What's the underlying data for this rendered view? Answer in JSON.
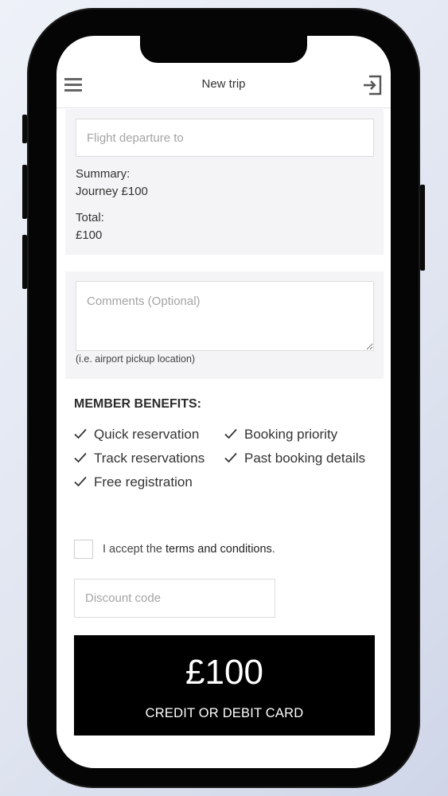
{
  "header": {
    "title": "New trip",
    "menu_icon": "hamburger-menu-icon",
    "exit_icon": "sign-out-icon"
  },
  "booking": {
    "destination_placeholder": "Flight departure to",
    "summary_label": "Summary:",
    "summary_value": "Journey £100",
    "total_label": "Total:",
    "total_value": "£100"
  },
  "comments": {
    "placeholder": "Comments (Optional)",
    "hint": "(i.e. airport pickup location)"
  },
  "benefits": {
    "title": "MEMBER BENEFITS:",
    "items": [
      "Quick reservation",
      "Booking priority",
      "Track reservations",
      "Past booking details",
      "Free registration"
    ]
  },
  "terms": {
    "prefix": "I accept the ",
    "link": "terms and conditions",
    "suffix": "."
  },
  "discount": {
    "placeholder": "Discount code"
  },
  "payment": {
    "amount": "£100",
    "label": "CREDIT OR DEBIT CARD"
  },
  "colors": {
    "button_background": "#000000",
    "button_text": "#ffffff",
    "panel_background": "#f4f4f6"
  }
}
